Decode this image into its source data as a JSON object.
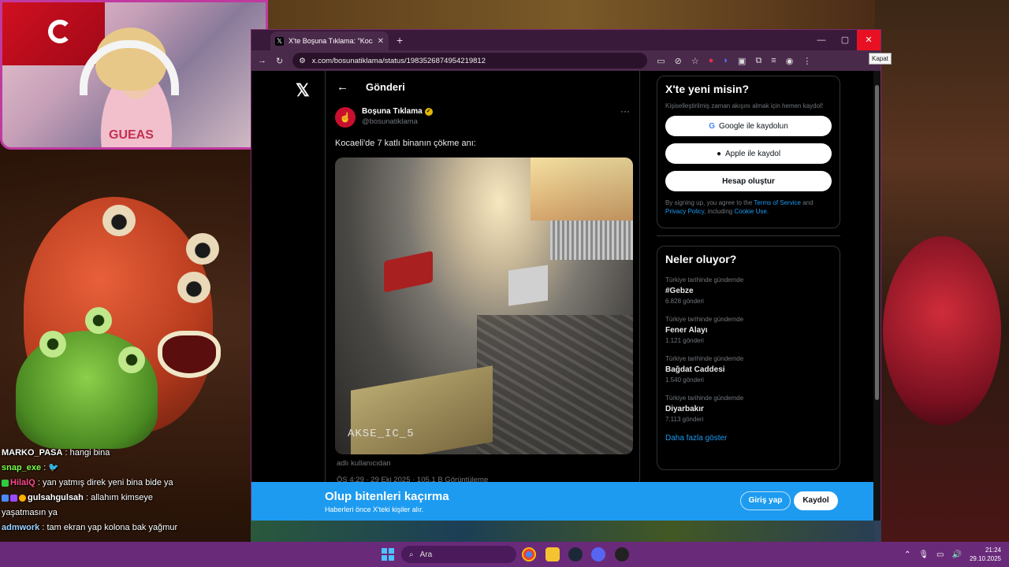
{
  "browser": {
    "tab_title": "X'te Boşuna Tıklama: \"Kocaeli'd",
    "url": "x.com/bosunatiklama/status/1983526874954219812",
    "close_tooltip": "Kapat"
  },
  "page": {
    "header_title": "Gönderi",
    "post": {
      "author_name": "Boşuna Tıklama",
      "author_handle": "@bosunatiklama",
      "text": "Kocaeli'de 7 katlı binanın çökme anı:",
      "media_watermark": "AKSE_IC_5",
      "caption": "adlı kullanıcıdan",
      "meta": "ÖS 4:29 · 29 Eki 2025 · 105,1 B Görüntüleme"
    },
    "signup": {
      "title": "X'te yeni misin?",
      "subtitle": "Kişiselleştirilmiş zaman akışını almak için hemen kaydol!",
      "google": "Google ile kaydolun",
      "apple": "Apple ile kaydol",
      "create": "Hesap oluştur",
      "legal_prefix": "By signing up, you agree to the",
      "terms": "Terms of Service",
      "and": "and",
      "privacy": "Privacy Policy",
      "including": ", including",
      "cookie": "Cookie Use."
    },
    "trends": {
      "title": "Neler oluyor?",
      "items": [
        {
          "context": "Türkiye tarihinde gündemde",
          "name": "#Gebze",
          "count": "6.828 gönderi"
        },
        {
          "context": "Türkiye tarihinde gündemde",
          "name": "Fener Alayı",
          "count": "1.121 gönderi"
        },
        {
          "context": "Türkiye tarihinde gündemde",
          "name": "Bağdat Caddesi",
          "count": "1.540 gönderi"
        },
        {
          "context": "Türkiye tarihinde gündemde",
          "name": "Diyarbakır",
          "count": "7.113 gönderi"
        }
      ],
      "more": "Daha fazla göster"
    },
    "banner": {
      "title": "Olup bitenleri kaçırma",
      "subtitle": "Haberleri önce X'teki kişiler alır.",
      "login": "Giriş yap",
      "signup": "Kaydol"
    }
  },
  "chat": [
    {
      "user": "MARKO_PASA",
      "msg": "hangi bina",
      "color": "#ffffff"
    },
    {
      "user": "snap_exe",
      "msg": "",
      "color": "#7cff4a"
    },
    {
      "user": "HilalQ",
      "msg": "yan yatmış direk yeni bina bide ya",
      "color": "#ff4a8a"
    },
    {
      "user": "gulsahgulsah",
      "msg": "allahım kimseye yaşatmasın ya",
      "color": "#ffffff"
    },
    {
      "user": "admwork",
      "msg": "tam ekran yap kolona bak yağmur",
      "color": "#9ad0ff"
    }
  ],
  "taskbar": {
    "search_placeholder": "Ara",
    "time": "21:24",
    "date": "29.10.2025"
  },
  "webcam": {
    "shirt_text": "GUEAS"
  },
  "colors": {
    "x_blue": "#1d9bf0",
    "taskbar": "#6a2a7a",
    "close_red": "#e81123"
  }
}
